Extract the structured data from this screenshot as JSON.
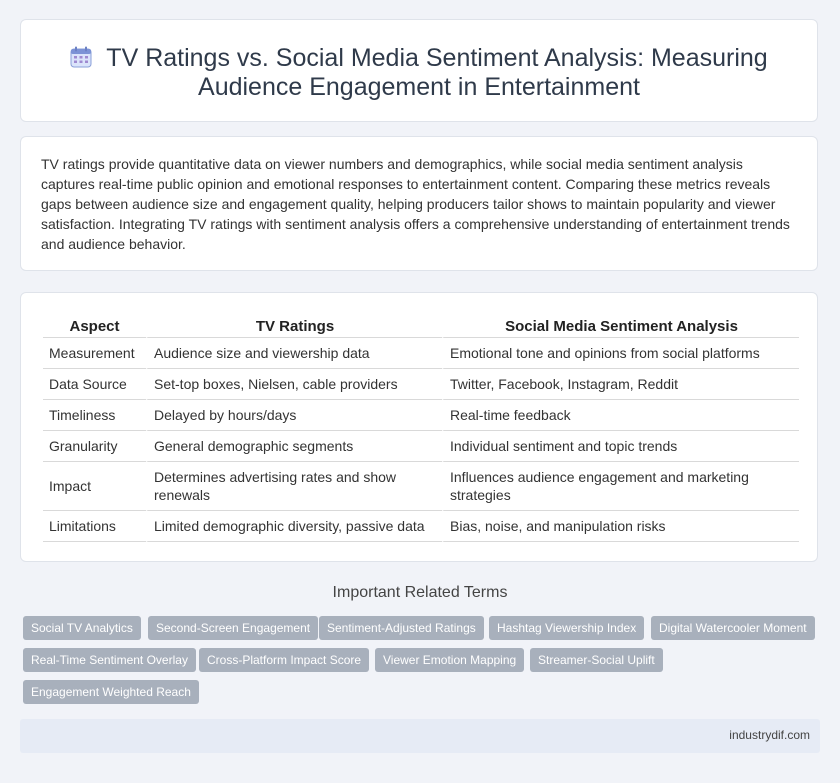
{
  "header": {
    "icon": "calendar-icon",
    "title_line1": "TV Ratings vs. Social Media Sentiment Analysis: Measuring",
    "title_line2": "Audience Engagement in Entertainment"
  },
  "intro": "TV ratings provide quantitative data on viewer numbers and demographics, while social media sentiment analysis captures real-time public opinion and emotional responses to entertainment content. Comparing these metrics reveals gaps between audience size and engagement quality, helping producers tailor shows to maintain popularity and viewer satisfaction. Integrating TV ratings with sentiment analysis offers a comprehensive understanding of entertainment trends and audience behavior.",
  "table": {
    "headers": [
      "Aspect",
      "TV Ratings",
      "Social Media Sentiment Analysis"
    ],
    "rows": [
      [
        "Measurement",
        "Audience size and viewership data",
        "Emotional tone and opinions from social platforms"
      ],
      [
        "Data Source",
        "Set-top boxes, Nielsen, cable providers",
        "Twitter, Facebook, Instagram, Reddit"
      ],
      [
        "Timeliness",
        "Delayed by hours/days",
        "Real-time feedback"
      ],
      [
        "Granularity",
        "General demographic segments",
        "Individual sentiment and topic trends"
      ],
      [
        "Impact",
        "Determines advertising rates and show renewals",
        "Influences audience engagement and marketing strategies"
      ],
      [
        "Limitations",
        "Limited demographic diversity, passive data",
        "Bias, noise, and manipulation risks"
      ]
    ]
  },
  "related": {
    "title": "Important Related Terms",
    "tags": [
      "Social TV Analytics",
      "Second-Screen Engagement",
      "Sentiment-Adjusted Ratings",
      "Hashtag Viewership Index",
      "Digital Watercooler Moment",
      "Real-Time Sentiment Overlay",
      "Cross-Platform Impact Score",
      "Viewer Emotion Mapping",
      "Streamer-Social Uplift",
      "Engagement Weighted Reach"
    ]
  },
  "footer": {
    "site": "industrydif.com"
  },
  "colors": {
    "tag_bg": "#a8b0bc",
    "footer_bg": "#e6ebf5",
    "page_bg": "#f1f3f8"
  }
}
